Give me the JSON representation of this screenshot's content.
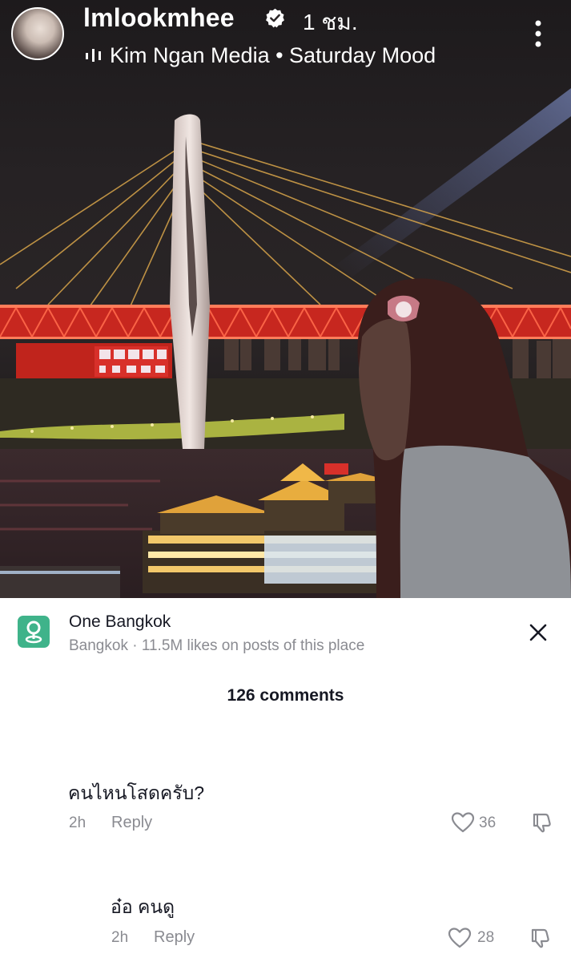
{
  "header": {
    "username": "lmlookmhee",
    "time_ago": "1 ชม.",
    "music": "Kim Ngan Media • Saturday Mood",
    "verified_icon": "verified-badge-icon",
    "music_icon": "sound-wave-icon",
    "more_icon": "more-vertical-icon"
  },
  "place": {
    "name": "One Bangkok",
    "subtitle": "Bangkok · 11.5M likes on posts of this place",
    "icon": "location-pin-icon",
    "icon_color": "#3fb38a"
  },
  "comments_count": "126 comments",
  "comments": [
    {
      "text": "คนไหนโสดครับ?",
      "time": "2h",
      "reply": "Reply",
      "likes": "36"
    },
    {
      "text": "อ๋อ คนดู",
      "time": "2h",
      "reply": "Reply",
      "likes": "28"
    }
  ],
  "colors": {
    "bridge_red": "#e2332a",
    "text_primary": "#161823",
    "text_secondary": "#8a8b91"
  }
}
